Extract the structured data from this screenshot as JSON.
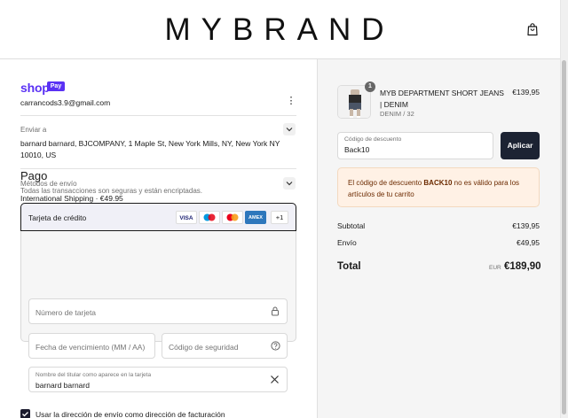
{
  "header": {
    "brand": "MYBRAND",
    "cart_icon": "shopping-bag-icon"
  },
  "account": {
    "shop_logo": "shop",
    "pay_badge": "Pay",
    "email": "carrancods3.9@gmail.com"
  },
  "shipping_to": {
    "label": "Enviar a",
    "address": "barnard barnard, BJCOMPANY, 1 Maple St, New York Mills, NY, New York NY 10010, US"
  },
  "shipping_method": {
    "label": "Métodos de envío",
    "value": "International Shipping · €49.95"
  },
  "payment": {
    "title": "Pago",
    "subtitle": "Todas las transacciones son seguras y están encriptadas.",
    "method_label": "Tarjeta de crédito",
    "card_brands": [
      "VISA",
      "Maestro",
      "Mastercard",
      "AMEX"
    ],
    "more_brands": "+1",
    "card_number_placeholder": "Número de tarjeta",
    "expiry_placeholder": "Fecha de vencimiento (MM / AA)",
    "security_placeholder": "Código de seguridad",
    "name_label": "Nombre del titular como aparece en la tarjeta",
    "name_value": "barnard barnard",
    "billing_checkbox": "Usar la dirección de envío como dirección de facturación"
  },
  "order": {
    "quantity": "1",
    "product_name": "MYB DEPARTMENT SHORT JEANS | DENIM",
    "variant": "DENIM / 32",
    "price": "€139,95"
  },
  "discount": {
    "label": "Código de descuento",
    "value": "Back10",
    "apply": "Aplicar",
    "error_prefix": "El código de descuento ",
    "error_code": "BACK10",
    "error_suffix": " no es válido para los artículos de tu carrito"
  },
  "summary": {
    "subtotal_label": "Subtotal",
    "subtotal_value": "€139,95",
    "shipping_label": "Envío",
    "shipping_value": "€49,95",
    "total_label": "Total",
    "currency": "EUR",
    "total_value": "€189,90"
  },
  "colors": {
    "shop_purple": "#5a31f4",
    "apply_button": "#1c2333",
    "alert_bg": "#fff1e5",
    "alert_text": "#6b2a00"
  }
}
